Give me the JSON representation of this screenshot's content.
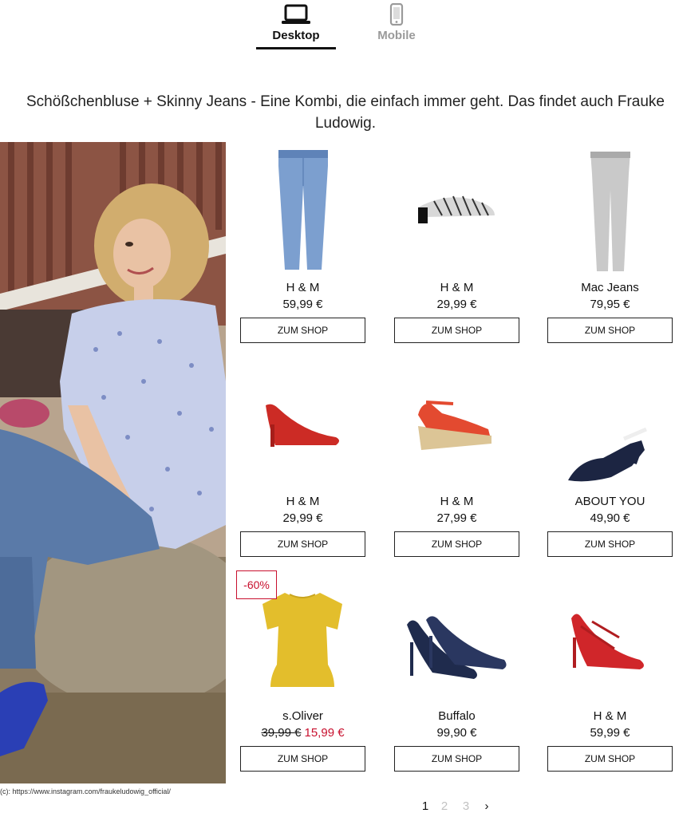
{
  "tabs": {
    "desktop": {
      "label": "Desktop",
      "icon": "laptop-icon",
      "active": true
    },
    "mobile": {
      "label": "Mobile",
      "icon": "smartphone-icon",
      "active": false
    }
  },
  "headline": "Schößchenbluse + Skinny Jeans - Eine Kombi, die einfach immer geht. Das findet auch Frauke Ludowig.",
  "hero": {
    "credit": "(c): https://www.instagram.com/fraukeludowig_official/"
  },
  "products": [
    {
      "brand": "H & M",
      "price": "59,99 €",
      "button": "ZUM SHOP",
      "item": "jeans-blue"
    },
    {
      "brand": "H & M",
      "price": "29,99 €",
      "button": "ZUM SHOP",
      "item": "striped-mule"
    },
    {
      "brand": "Mac Jeans",
      "price": "79,95 €",
      "button": "ZUM SHOP",
      "item": "jeans-grey"
    },
    {
      "brand": "H & M",
      "price": "29,99 €",
      "button": "ZUM SHOP",
      "item": "red-pump"
    },
    {
      "brand": "H & M",
      "price": "27,99 €",
      "button": "ZUM SHOP",
      "item": "red-wedge-sandal"
    },
    {
      "brand": "ABOUT YOU",
      "price": "49,90 €",
      "button": "ZUM SHOP",
      "item": "navy-slingback"
    },
    {
      "brand": "s.Oliver",
      "price_old": "39,99 €",
      "price_new": "15,99 €",
      "badge": "-60%",
      "button": "ZUM SHOP",
      "item": "yellow-peplum-top"
    },
    {
      "brand": "Buffalo",
      "price": "99,90 €",
      "button": "ZUM SHOP",
      "item": "navy-stilettos"
    },
    {
      "brand": "H & M",
      "price": "59,99 €",
      "button": "ZUM SHOP",
      "item": "red-strappy-heel"
    }
  ],
  "pagination": {
    "pages": [
      "1",
      "2",
      "3"
    ],
    "current": "1",
    "next": "›"
  },
  "colors": {
    "accent": "#c8102e",
    "text": "#111111",
    "inactive": "#9a9a9a"
  }
}
